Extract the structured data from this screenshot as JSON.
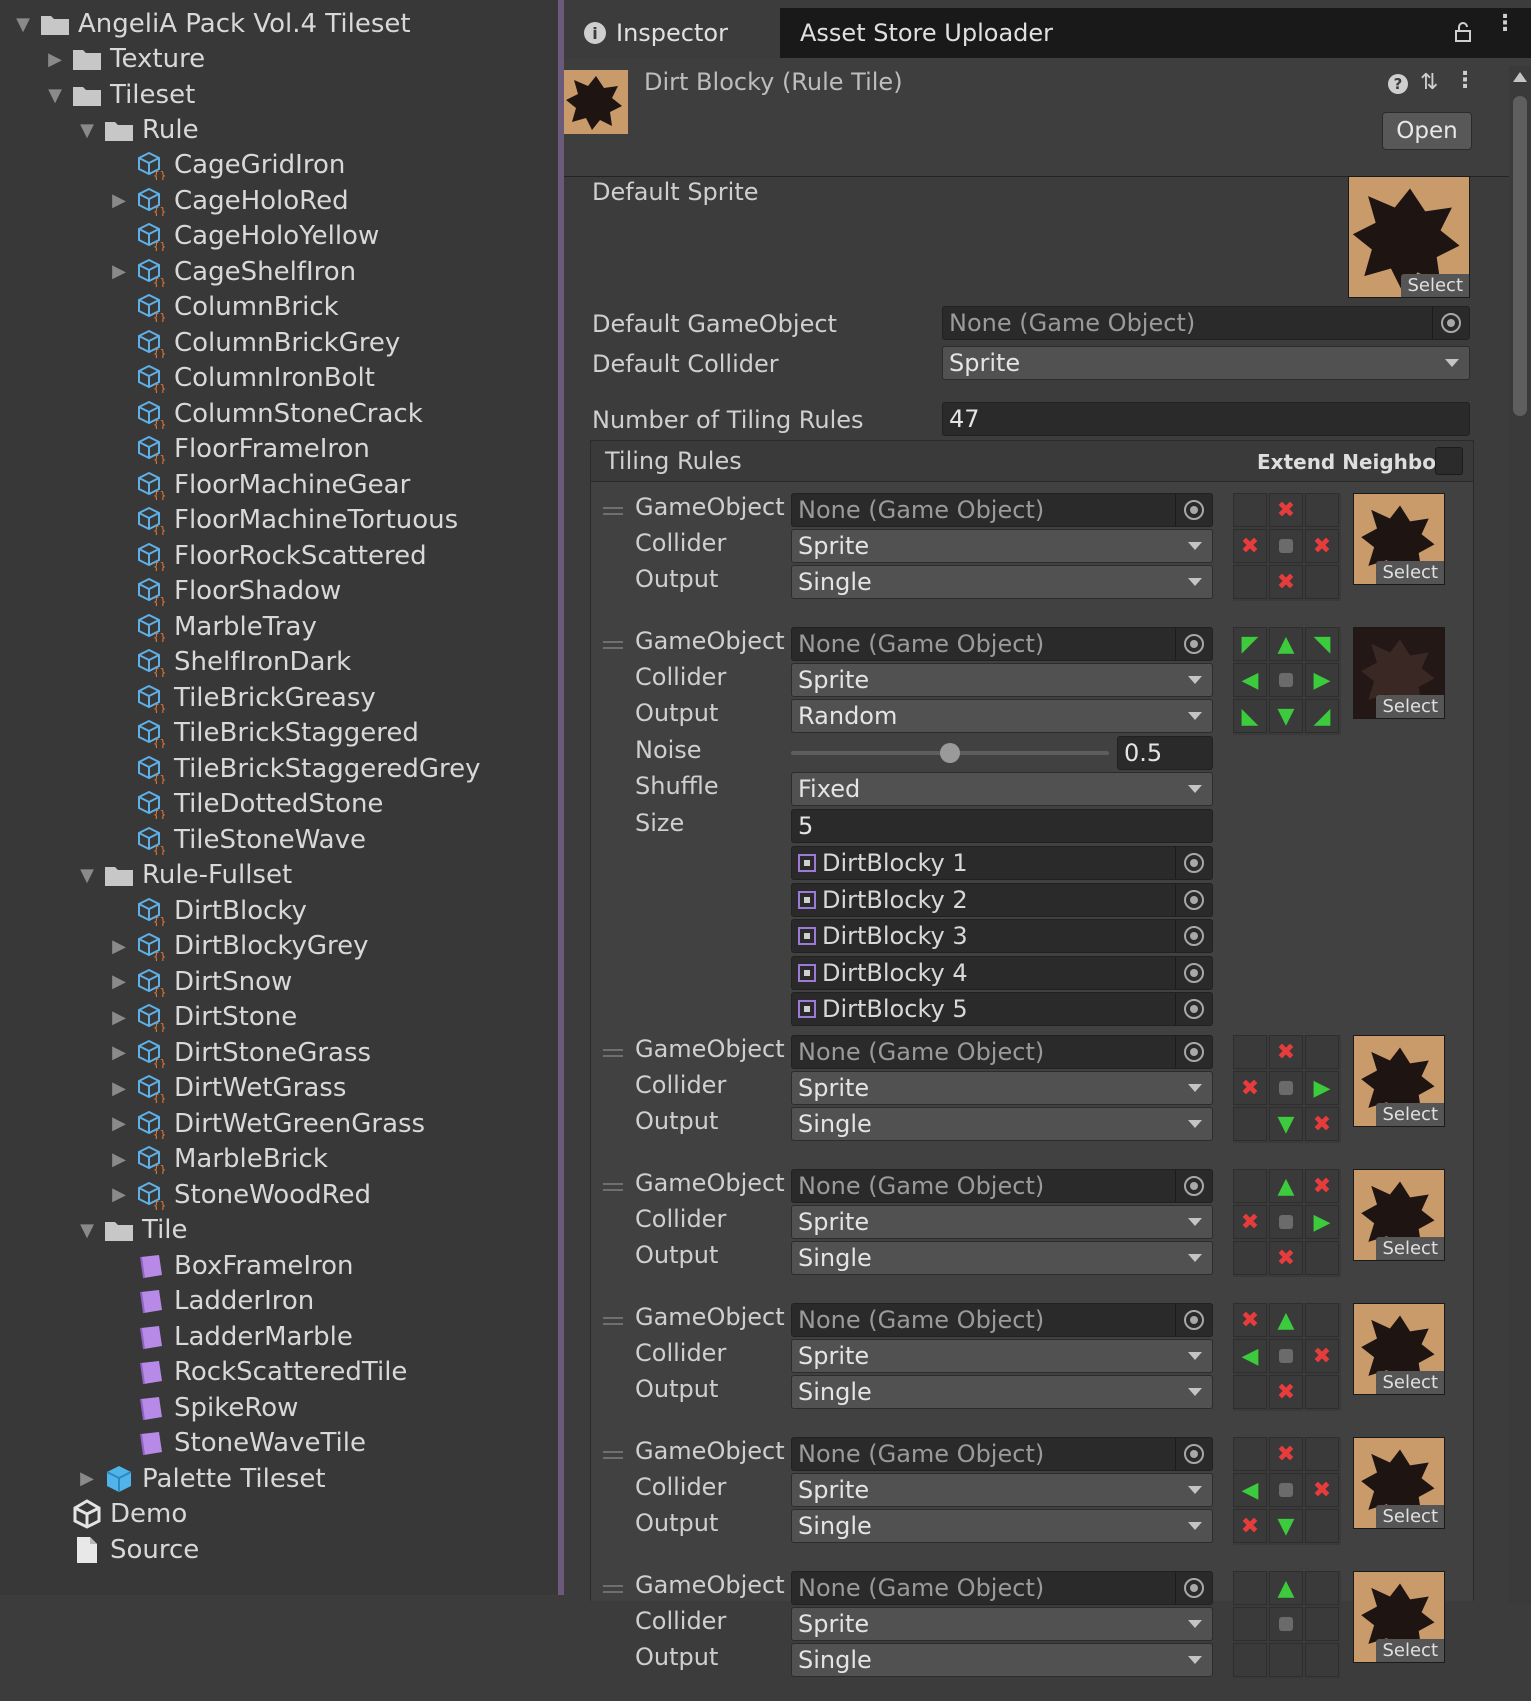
{
  "project_tree": {
    "root": "AngeliA Pack Vol.4 Tileset",
    "texture": "Texture",
    "tileset": "Tileset",
    "rule_folder": "Rule",
    "rule_items": [
      "CageGridIron",
      "CageHoloRed",
      "CageHoloYellow",
      "CageShelfIron",
      "ColumnBrick",
      "ColumnBrickGrey",
      "ColumnIronBolt",
      "ColumnStoneCrack",
      "FloorFrameIron",
      "FloorMachineGear",
      "FloorMachineTortuous",
      "FloorRockScattered",
      "FloorShadow",
      "MarbleTray",
      "ShelfIronDark",
      "TileBrickGreasy",
      "TileBrickStaggered",
      "TileBrickStaggeredGrey",
      "TileDottedStone",
      "TileStoneWave"
    ],
    "rule_fullset_folder": "Rule-Fullset",
    "rule_fullset_items": [
      "DirtBlocky",
      "DirtBlockyGrey",
      "DirtSnow",
      "DirtStone",
      "DirtStoneGrass",
      "DirtWetGrass",
      "DirtWetGreenGrass",
      "MarbleBrick",
      "StoneWoodRed"
    ],
    "tile_folder": "Tile",
    "tile_items": [
      "BoxFrameIron",
      "LadderIron",
      "LadderMarble",
      "RockScatteredTile",
      "SpikeRow",
      "StoneWaveTile"
    ],
    "palette": "Palette Tileset",
    "demo": "Demo",
    "source": "Source"
  },
  "tabs": {
    "inspector": "Inspector",
    "asset_store": "Asset Store Uploader"
  },
  "header": {
    "title": "Dirt Blocky (Rule Tile)",
    "open_button": "Open"
  },
  "props": {
    "default_sprite_label": "Default Sprite",
    "select": "Select",
    "default_gameobject_label": "Default GameObject",
    "default_gameobject_value": "None (Game Object)",
    "default_collider_label": "Default Collider",
    "default_collider_value": "Sprite",
    "num_rules_label": "Number of Tiling Rules",
    "num_rules_value": "47"
  },
  "tiling": {
    "title": "Tiling Rules",
    "extend_neighbor": "Extend Neighbor",
    "lbl_gameobject": "GameObject",
    "lbl_collider": "Collider",
    "lbl_output": "Output",
    "lbl_noise": "Noise",
    "lbl_shuffle": "Shuffle",
    "lbl_size": "Size",
    "none_go": "None (Game Object)",
    "sprite": "Sprite",
    "single": "Single",
    "random": "Random",
    "noise_value": "0.5",
    "noise_fraction": 0.5,
    "shuffle_value": "Fixed",
    "size_value": "5",
    "sprites": [
      "DirtBlocky 1",
      "DirtBlocky 2",
      "DirtBlocky 3",
      "DirtBlocky 4",
      "DirtBlocky 5"
    ]
  },
  "colors": {
    "accent_green": "#3ccb3c",
    "accent_red": "#e83c3c",
    "panel": "#3c3c3c"
  }
}
